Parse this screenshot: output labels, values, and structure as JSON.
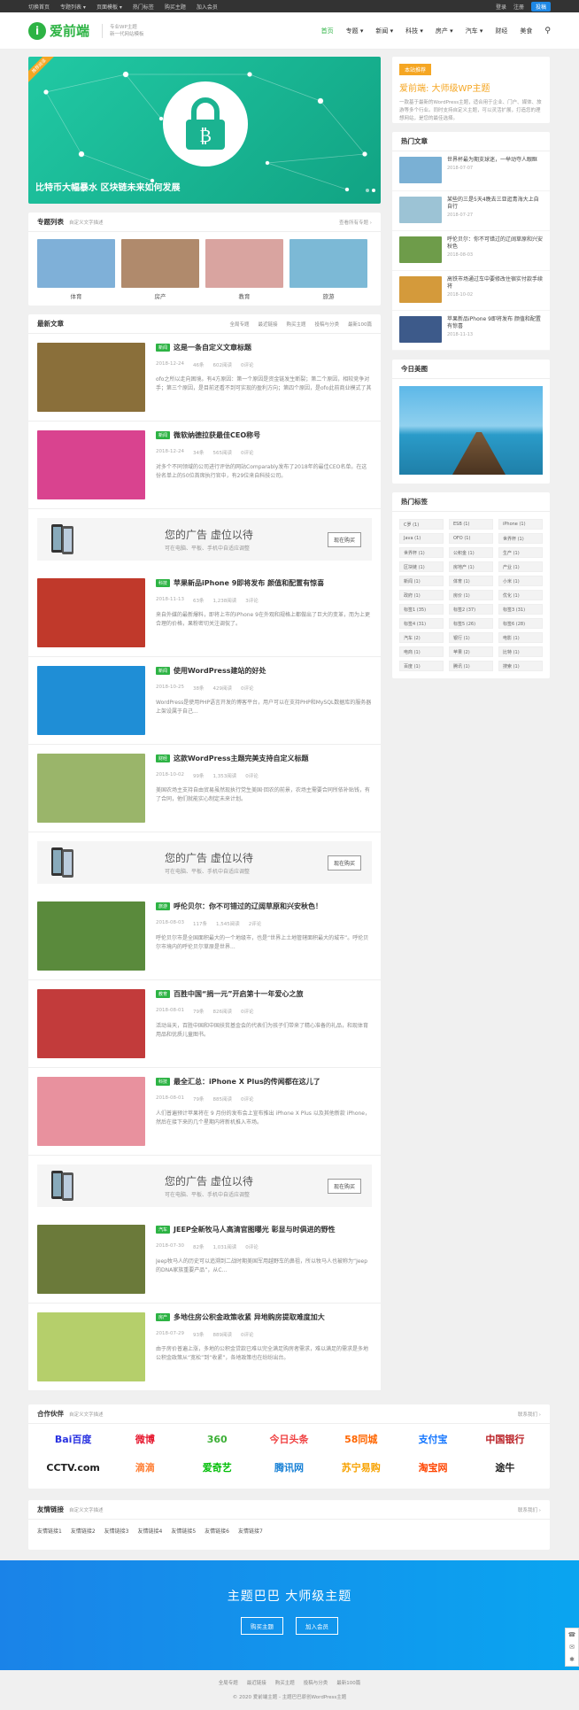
{
  "topbar": {
    "left": [
      "切换首页",
      "专题列表 ▾",
      "页面模板 ▾",
      "热门标签",
      "购买主题",
      "加入会员"
    ],
    "login": "登录",
    "register": "注册",
    "signup": "投稿"
  },
  "header": {
    "logo_letter": "i",
    "logo_text": "爱前端",
    "slogan1": "专业WP主题",
    "slogan2": "新一代网站模板",
    "nav": [
      "首页",
      "专题 ▾",
      "新闻 ▾",
      "科技 ▾",
      "房产 ▾",
      "汽车 ▾",
      "财经",
      "美食"
    ],
    "search_icon": "search-icon"
  },
  "slider": {
    "badge": "推荐阅读",
    "caption": "比特币大幅暴水 区块链未来如何发展"
  },
  "topics": {
    "title": "专题列表",
    "subtitle": "自定义文字描述",
    "more": "查看所有专题 ›",
    "items": [
      {
        "label": "体育",
        "color": "#7fb0d8"
      },
      {
        "label": "房产",
        "color": "#b08a6c"
      },
      {
        "label": "教育",
        "color": "#d9a4a0"
      },
      {
        "label": "旅游",
        "color": "#7cb9d6"
      }
    ]
  },
  "latest": {
    "title": "最新文章",
    "tabs": [
      "全局专题",
      "最近链接",
      "购买主题",
      "投稿与分类",
      "最新100篇"
    ]
  },
  "articles": [
    {
      "tag": "新闻",
      "tag_color": "#2db344",
      "title": "这是一条自定义文章标题",
      "date": "2018-12-24",
      "author": "46条",
      "views": "602阅读",
      "likes": "0评论",
      "summary": "ofo之所以走向困境。有4方原因：第一个原因是资金链发生断裂；第二个原因，相较竞争对手；第三个原因，是目前还看不到可实现的盈利方向；第四个原因，是ofo此前商业模式了其线。",
      "thumb": "#8a6f3a"
    },
    {
      "tag": "新闻",
      "tag_color": "#2db344",
      "title": "微软纳德拉获最佳CEO称号",
      "date": "2018-12-24",
      "author": "34条",
      "views": "565阅读",
      "likes": "0评论",
      "summary": "对多个不同领域的公司进行评估的网站Comparably发布了2018年的最佳CEO名单。在这份名单上的50位首席执行官中，有29位来自科技公司。",
      "thumb": "#d9438f"
    },
    {
      "tag": "科技",
      "tag_color": "#2db344",
      "title": "苹果新品iPhone 9即将发布 颜值和配置有惊喜",
      "date": "2018-11-13",
      "author": "63条",
      "views": "1,238阅读",
      "likes": "3评论",
      "summary": "来自外媒的最新爆料，即将上市的iPhone 9在外观和规格上都做出了巨大的变革，而为上更合理的价格，果粉密切关注调侃了。",
      "thumb": "#c0392b"
    },
    {
      "tag": "新闻",
      "tag_color": "#2db344",
      "title": "使用WordPress建站的好处",
      "date": "2018-10-25",
      "author": "38条",
      "views": "429阅读",
      "likes": "0评论",
      "summary": "WordPress是使用PHP语言开发的博客平台，用户可以在支持PHP和MySQL数据库的服务器上架设属于自己...",
      "thumb": "#1f8ed6"
    },
    {
      "tag": "财经",
      "tag_color": "#2db344",
      "title": "这款WordPress主题完美支持自定义标题",
      "title_hl": "自定义标题",
      "date": "2018-10-02",
      "author": "99条",
      "views": "1,353阅读",
      "likes": "0评论",
      "summary": "美国农场主支持自由贸易虽然现执行党生美国·回农的前景，农场主需要合同所依补贴钱，有了合同，他们就能实心制定未来计划。",
      "thumb": "#9ab56a"
    },
    {
      "tag": "旅游",
      "tag_color": "#2db344",
      "title": "呼伦贝尔：你不可错过的辽阔草原和兴安秋色！",
      "date": "2018-08-03",
      "author": "117条",
      "views": "1,545阅读",
      "likes": "2评论",
      "summary": "呼伦贝尔市是全国面积最大的一个地级市，也是“世界上土地管辖面积最大的城市”。呼伦贝尔市境内的呼伦贝尔草原是世界...",
      "thumb": "#5a8a3c"
    },
    {
      "tag": "教育",
      "tag_color": "#2db344",
      "title": "百胜中国“捐一元”开启第十一年爱心之旅",
      "date": "2018-08-01",
      "author": "79条",
      "views": "826阅读",
      "likes": "0评论",
      "summary": "活动当天，百胜中国和中国扶贫基金会的代表们为孩子们带来了精心准备的礼品，和现体育用品和优质儿童图书。",
      "thumb": "#c23b3b"
    },
    {
      "tag": "科技",
      "tag_color": "#2db344",
      "title": "最全汇总：iPhone X Plus的传闻都在这儿了",
      "title_hl": "iPhone X Plus",
      "date": "2018-08-01",
      "author": "79条",
      "views": "885阅读",
      "likes": "0评论",
      "summary": "人们普遍预计苹果将在 9 月份的发布会上宣布推出 iPhone X Plus 以及其他新款 iPhone，然后在接下来的几个星期内将新机推入市场。",
      "thumb": "#e8919e"
    },
    {
      "tag": "汽车",
      "tag_color": "#2db344",
      "title": "JEEP全新牧马人高清官图曝光 彰显与时俱进的野性",
      "date": "2018-07-30",
      "author": "82条",
      "views": "1,031阅读",
      "likes": "0评论",
      "summary": "Jeep牧马人的历史可以追溯到二战时期美国军用越野车的鼻祖，所以牧马人也被称为“Jeep的DNA家族重要产品”，从C...",
      "thumb": "#6b7a3a"
    },
    {
      "tag": "房产",
      "tag_color": "#2db344",
      "title": "多地住房公积金政策收紧 异地购房提取难度加大",
      "title_hl": "难度加大",
      "date": "2018-07-29",
      "author": "93条",
      "views": "889阅读",
      "likes": "0评论",
      "summary": "由于房价普遍上涨，多地的公积金贷款已难以完全满足购房者需求，难以满足的需求是多地公积金政策从“宽松”到“收紧”，各地政策也在纷纷出台。",
      "thumb": "#b5cf6b"
    }
  ],
  "ad": {
    "title": "您的广告 虚位以待",
    "sub": "可在电脑、平板、手机中自适应调整",
    "btn": "现在购买"
  },
  "side": {
    "rec": {
      "head": "本站推荐",
      "title": "爱前端: 大师级WP主题",
      "desc": "一款基于最新的WordPress主题，适合用于企业、门户、媒体、旅游等多个行业。同时支持自定义主题，可以灵活扩展，打造您的理想网站，是您的最佳选择。"
    },
    "hot": {
      "title": "热门文章",
      "items": [
        {
          "t": "世界杯最为期支球迷，一举动夺人眼眶",
          "d": "2018-07-07",
          "c": "#7ab0d4"
        },
        {
          "t": "某些的三是5天4晚去三亚逛青海大上自自行",
          "d": "2018-07-27",
          "c": "#9cc3d5"
        },
        {
          "t": "呼伦贝尔：你不可错过的辽阔草原和兴安秋色",
          "d": "2018-08-03",
          "c": "#6e9c4a"
        },
        {
          "t": "高铁市场通过车中要修改住宿实付款手续将",
          "d": "2018-10-02",
          "c": "#d49a3b"
        },
        {
          "t": "苹果新品iPhone 9即将发布 颜值和配置有惊喜",
          "d": "2018-11-13",
          "c": "#3d5a8a"
        }
      ]
    },
    "img": {
      "title": "今日美图"
    },
    "tagsbox": {
      "title": "热门标签",
      "tags": [
        "C罗 (1)",
        "ESB (1)",
        "iPhone (1)",
        "Java (1)",
        "OFO (1)",
        "世界杯 (1)",
        "世界杯 (1)",
        "公积金 (1)",
        "生产 (1)",
        "区块链 (1)",
        "房地产 (1)",
        "产业 (1)",
        "新闻 (1)",
        "体育 (1)",
        "小米 (1)",
        "政府 (1)",
        "房价 (1)",
        "优化 (1)",
        "标签1 (35)",
        "标签2 (37)",
        "标签3 (31)",
        "标签4 (31)",
        "标签5 (26)",
        "标签6 (28)",
        "汽车 (2)",
        "银行 (1)",
        "电影 (1)",
        "电商 (1)",
        "苹果 (2)",
        "比特 (1)",
        "百度 (1)",
        "腾讯 (1)",
        "搜索 (1)"
      ]
    }
  },
  "partners": {
    "title": "合作伙伴",
    "subtitle": "自定义文字描述",
    "more": "联系我们 ›",
    "logos": [
      {
        "n": "Bai百度",
        "c": "#2932e1"
      },
      {
        "n": "微博",
        "c": "#e6162d"
      },
      {
        "n": "360",
        "c": "#3caf36"
      },
      {
        "n": "今日头条",
        "c": "#f04142"
      },
      {
        "n": "58同城",
        "c": "#ff6600"
      },
      {
        "n": "支付宝",
        "c": "#1677ff"
      },
      {
        "n": "中国银行",
        "c": "#b81c22"
      },
      {
        "n": "CCTV.com",
        "c": "#222"
      },
      {
        "n": "滴滴",
        "c": "#ff7e33"
      },
      {
        "n": "爱奇艺",
        "c": "#00be06"
      },
      {
        "n": "腾讯网",
        "c": "#1a82d6"
      },
      {
        "n": "苏宁易购",
        "c": "#f7a200"
      },
      {
        "n": "淘宝网",
        "c": "#ff4400"
      },
      {
        "n": "途牛",
        "c": "#222"
      }
    ]
  },
  "links": {
    "title": "友情链接",
    "subtitle": "自定义文字描述",
    "more": "联系我们 ›",
    "items": [
      "友情链接1",
      "友情链接2",
      "友情链接3",
      "友情链接4",
      "友情链接5",
      "友情链接6",
      "友情链接7"
    ]
  },
  "banner": {
    "title": "主题巴巴 大师级主题",
    "btn1": "购买主题",
    "btn2": "加入会员"
  },
  "footer": {
    "links": [
      "全局专题",
      "最近链接",
      "购买主题",
      "投稿与分类",
      "最新100篇"
    ],
    "copy": "© 2020 爱前端主题 - 主题巴巴原创WordPress主题"
  }
}
